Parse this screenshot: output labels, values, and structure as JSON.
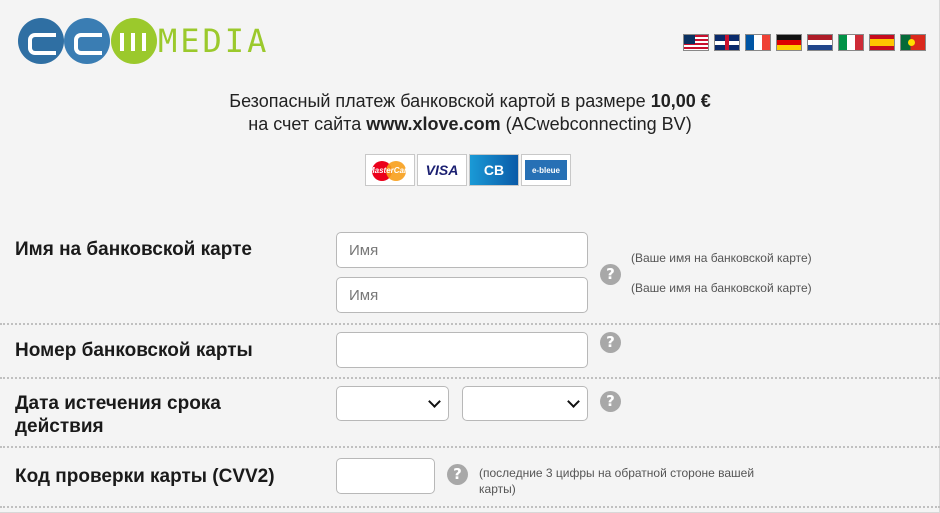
{
  "logo": {
    "text": "MEDIA",
    "brand_colors": [
      "#2f6fa3",
      "#9bc92c"
    ]
  },
  "languages": [
    {
      "icon": "flag-us-icon"
    },
    {
      "icon": "flag-gb-icon"
    },
    {
      "icon": "flag-fr-icon"
    },
    {
      "icon": "flag-de-icon"
    },
    {
      "icon": "flag-nl-icon"
    },
    {
      "icon": "flag-it-icon"
    },
    {
      "icon": "flag-es-icon"
    },
    {
      "icon": "flag-pt-icon"
    }
  ],
  "intro": {
    "line1_prefix": "Безопасный платеж банковской картой в размере ",
    "amount": "10,00 €",
    "line2_prefix": "на счет сайта ",
    "site": "www.xlove.com",
    "line2_suffix": " (ACwebconnecting BV)"
  },
  "payment_methods": {
    "mastercard": "MasterCard",
    "visa": "VISA",
    "cb": "CB",
    "ebleue": "e-bleue"
  },
  "form": {
    "name": {
      "label": "Имя на банковской карте",
      "first_placeholder": "Имя",
      "second_placeholder": "Имя",
      "hint1": "(Ваше имя на банковской карте)",
      "hint2": "(Ваше имя на банковской карте)"
    },
    "number": {
      "label": "Номер банковской карты",
      "value": ""
    },
    "expiry": {
      "label_line1": "Дата истечения срока",
      "label_line2": "действия",
      "month": "",
      "year": ""
    },
    "cvv": {
      "label": "Код проверки карты (CVV2)",
      "hint_line1": "(последние 3 цифры на обратной стороне вашей",
      "hint_line2": "карты)"
    },
    "help_glyph": "?"
  }
}
